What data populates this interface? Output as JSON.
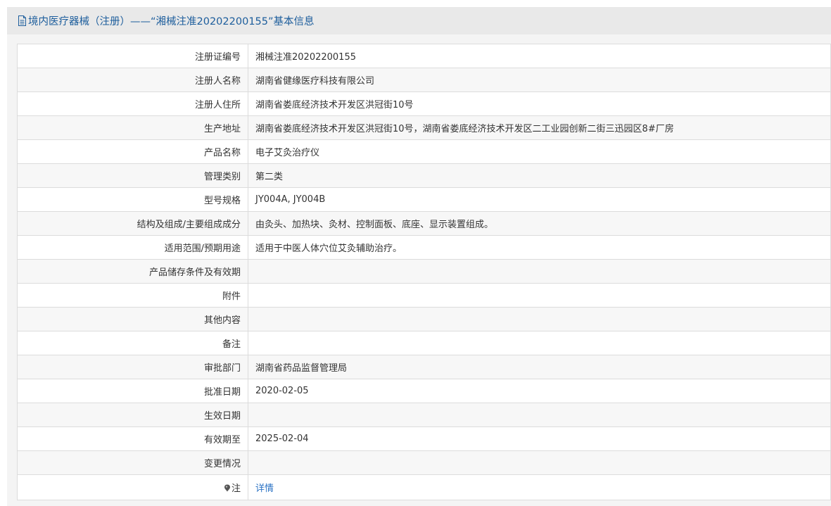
{
  "header": {
    "title": "境内医疗器械（注册）——“湘械注准20202200155”基本信息"
  },
  "rows": [
    {
      "label": "注册证编号",
      "value": "湘械注准20202200155"
    },
    {
      "label": "注册人名称",
      "value": "湖南省健缘医疗科技有限公司"
    },
    {
      "label": "注册人住所",
      "value": "湖南省娄底经济技术开发区洪冠街10号"
    },
    {
      "label": "生产地址",
      "value": "湖南省娄底经济技术开发区洪冠街10号，湖南省娄底经济技术开发区二工业园创新二街三迅园区8#厂房"
    },
    {
      "label": "产品名称",
      "value": "电子艾灸治疗仪"
    },
    {
      "label": "管理类别",
      "value": "第二类"
    },
    {
      "label": "型号规格",
      "value": "JY004A, JY004B"
    },
    {
      "label": "结构及组成/主要组成成分",
      "value": "由灸头、加热块、灸材、控制面板、底座、显示装置组成。"
    },
    {
      "label": "适用范围/预期用途",
      "value": "适用于中医人体穴位艾灸辅助治疗。"
    },
    {
      "label": "产品储存条件及有效期",
      "value": ""
    },
    {
      "label": "附件",
      "value": ""
    },
    {
      "label": "其他内容",
      "value": ""
    },
    {
      "label": "备注",
      "value": ""
    },
    {
      "label": "审批部门",
      "value": "湖南省药品监督管理局"
    },
    {
      "label": "批准日期",
      "value": "2020-02-05"
    },
    {
      "label": "生效日期",
      "value": ""
    },
    {
      "label": "有效期至",
      "value": "2025-02-04"
    },
    {
      "label": "变更情况",
      "value": ""
    }
  ],
  "note": {
    "label": "注",
    "link_text": "详情",
    "icon": "map-pin-icon"
  },
  "colors": {
    "title": "#1c5d9c",
    "link": "#2a72c4",
    "header_bg": "#e9e9e9",
    "border": "#dcdcdc"
  }
}
